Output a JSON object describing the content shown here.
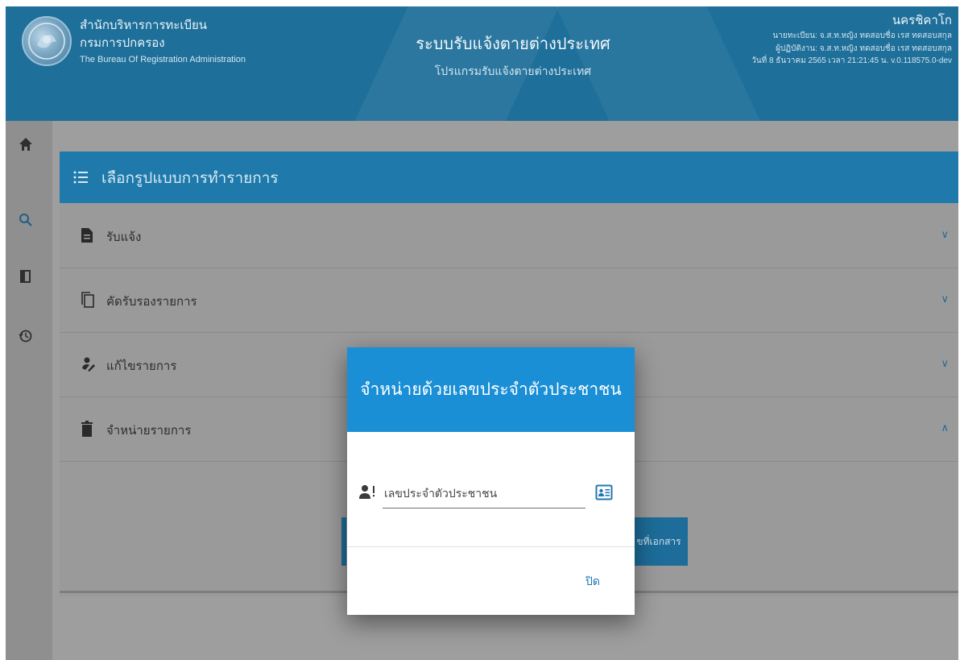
{
  "header": {
    "org_line1": "สำนักบริหารการทะเบียน",
    "org_line2": "กรมการปกครอง",
    "org_line3": "The Bureau Of Registration Administration",
    "app_title": "ระบบรับแจ้งตายต่างประเทศ",
    "app_subtitle": "โปรแกรมรับแจ้งตายต่างประเทศ",
    "user_name": "นครชิคาโก",
    "registrar": "นายทะเบียน: จ.ส.ท.หญิง ทดสอบชื่อ เรส ทดสอบสกุล",
    "operator": "ผู้ปฏิบัติงาน: จ.ส.ท.หญิง ทดสอบชื่อ เรส ทดสอบสกุล",
    "datetime_version": "วันที่ 8 ธันวาคม 2565 เวลา 21:21:45 น.  v.0.118575.0-dev"
  },
  "rail": {
    "icons": [
      "home-icon",
      "search-icon",
      "book-icon",
      "history-icon"
    ]
  },
  "card": {
    "title": "เลือกรูปแบบการทำรายการ",
    "rows": [
      {
        "label": "รับแจ้ง",
        "icon": "document-icon",
        "expanded": false
      },
      {
        "label": "คัดรับรองรายการ",
        "icon": "copy-icon",
        "expanded": false
      },
      {
        "label": "แก้ไขรายการ",
        "icon": "edit-person-icon",
        "expanded": false
      },
      {
        "label": "จำหน่ายรายการ",
        "icon": "trash-icon",
        "expanded": true
      }
    ],
    "partial_button_label": "ขที่เอกสาร"
  },
  "modal": {
    "title": "จำหน่ายด้วยเลขประจำตัวประชาชน",
    "input_placeholder": "เลขประจำตัวประชาชน",
    "input_value": "",
    "close_label": "ปิด"
  },
  "colors": {
    "header_bg": "#1e6f9a",
    "card_header_bg": "#1f7aab",
    "modal_header_bg": "#1a8fd6",
    "overlay_bg": "#9e9e9e",
    "link": "#1f77b4"
  }
}
